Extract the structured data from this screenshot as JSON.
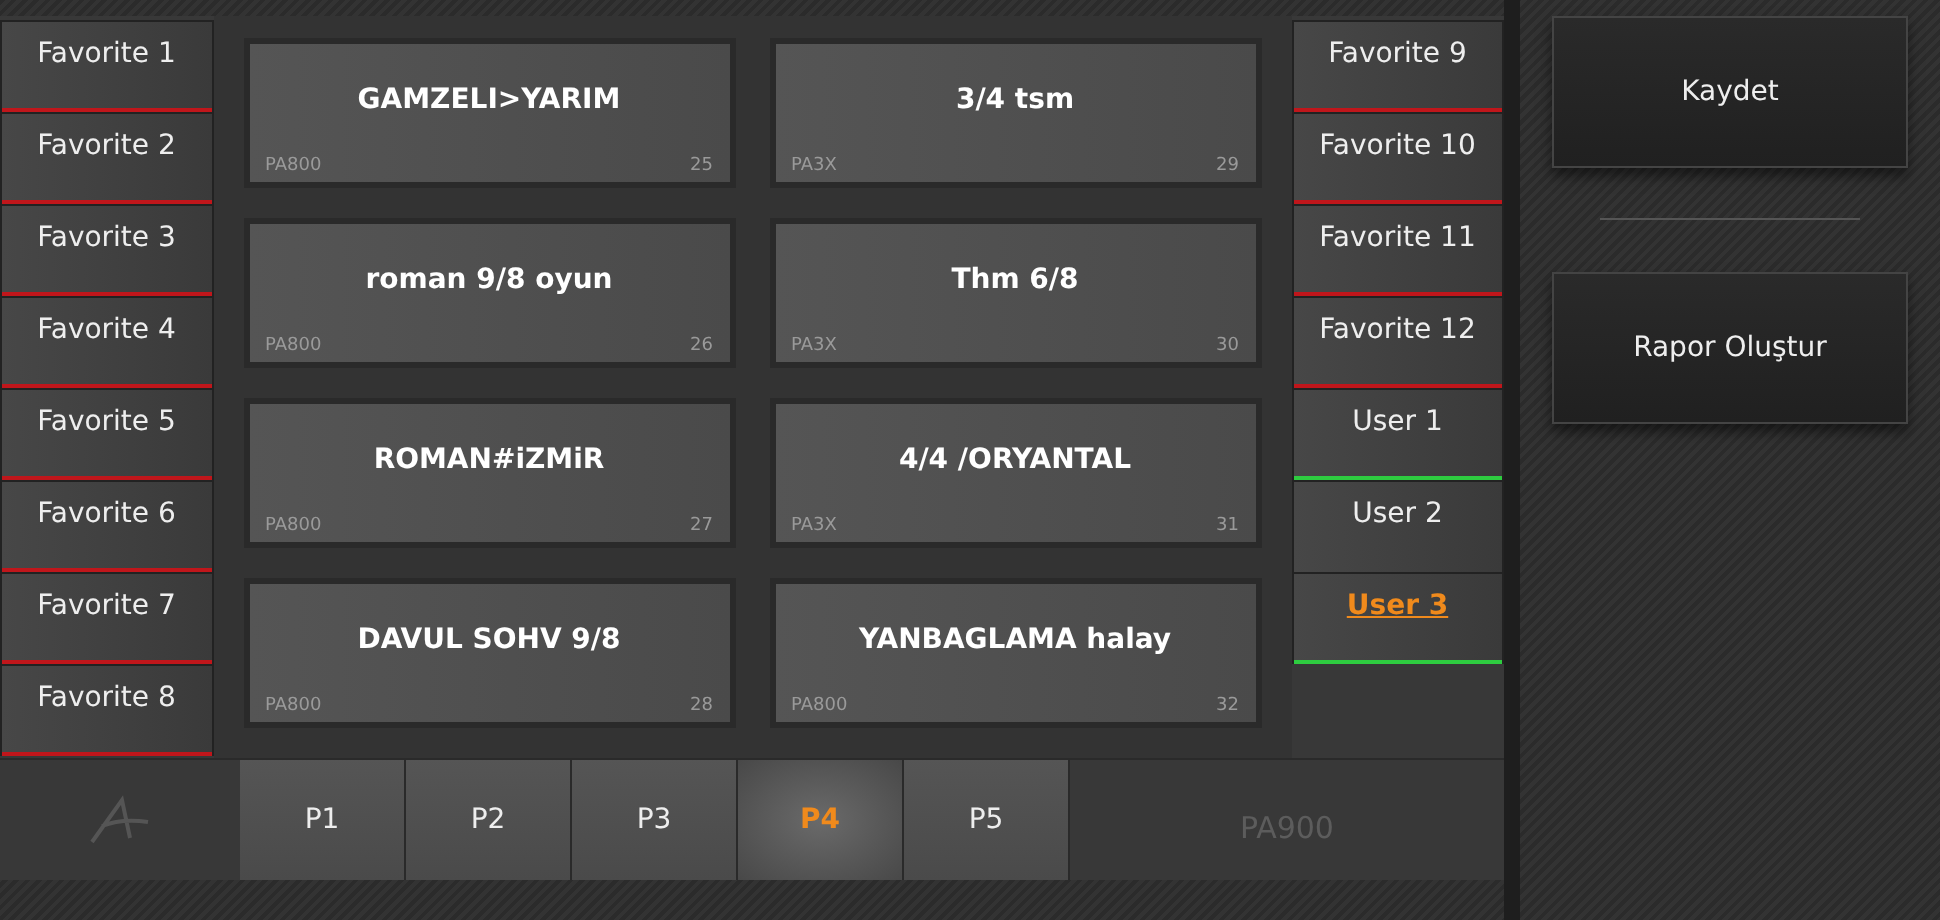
{
  "left_tabs": [
    {
      "label": "Favorite 1",
      "color": "#c0161b",
      "selected": false
    },
    {
      "label": "Favorite 2",
      "color": "#c0161b",
      "selected": false
    },
    {
      "label": "Favorite 3",
      "color": "#c0161b",
      "selected": false
    },
    {
      "label": "Favorite 4",
      "color": "#c0161b",
      "selected": false
    },
    {
      "label": "Favorite 5",
      "color": "#c0161b",
      "selected": false
    },
    {
      "label": "Favorite 6",
      "color": "#c0161b",
      "selected": false
    },
    {
      "label": "Favorite 7",
      "color": "#c0161b",
      "selected": false
    },
    {
      "label": "Favorite 8",
      "color": "#c0161b",
      "selected": false
    }
  ],
  "pads": [
    {
      "title": "GAMZELI>YARIM",
      "source": "PA800",
      "number": "25"
    },
    {
      "title": "3/4 tsm",
      "source": "PA3X",
      "number": "29"
    },
    {
      "title": "roman 9/8 oyun",
      "source": "PA800",
      "number": "26"
    },
    {
      "title": "Thm 6/8",
      "source": "PA3X",
      "number": "30"
    },
    {
      "title": "ROMAN#iZMiR",
      "source": "PA800",
      "number": "27"
    },
    {
      "title": "4/4 /ORYANTAL",
      "source": "PA3X",
      "number": "31"
    },
    {
      "title": "DAVUL SOHV 9/8",
      "source": "PA800",
      "number": "28"
    },
    {
      "title": "YANBAGLAMA halay",
      "source": "PA800",
      "number": "32"
    }
  ],
  "right_tabs": [
    {
      "label": "Favorite 9",
      "color": "#c0161b",
      "selected": false
    },
    {
      "label": "Favorite 10",
      "color": "#c0161b",
      "selected": false
    },
    {
      "label": "Favorite 11",
      "color": "#c0161b",
      "selected": false
    },
    {
      "label": "Favorite 12",
      "color": "#c0161b",
      "selected": false
    },
    {
      "label": "User 1",
      "color": "#2ecc40",
      "selected": false
    },
    {
      "label": "User 2",
      "selected": false
    },
    {
      "label": "User 3",
      "color": "#2ecc40",
      "selected": true
    }
  ],
  "pages": [
    {
      "label": "P1",
      "selected": false
    },
    {
      "label": "P2",
      "selected": false
    },
    {
      "label": "P3",
      "selected": false
    },
    {
      "label": "P4",
      "selected": true
    },
    {
      "label": "P5",
      "selected": false
    }
  ],
  "model": "PA900",
  "actions": [
    "Kaydet",
    "Rapor Oluştur"
  ]
}
